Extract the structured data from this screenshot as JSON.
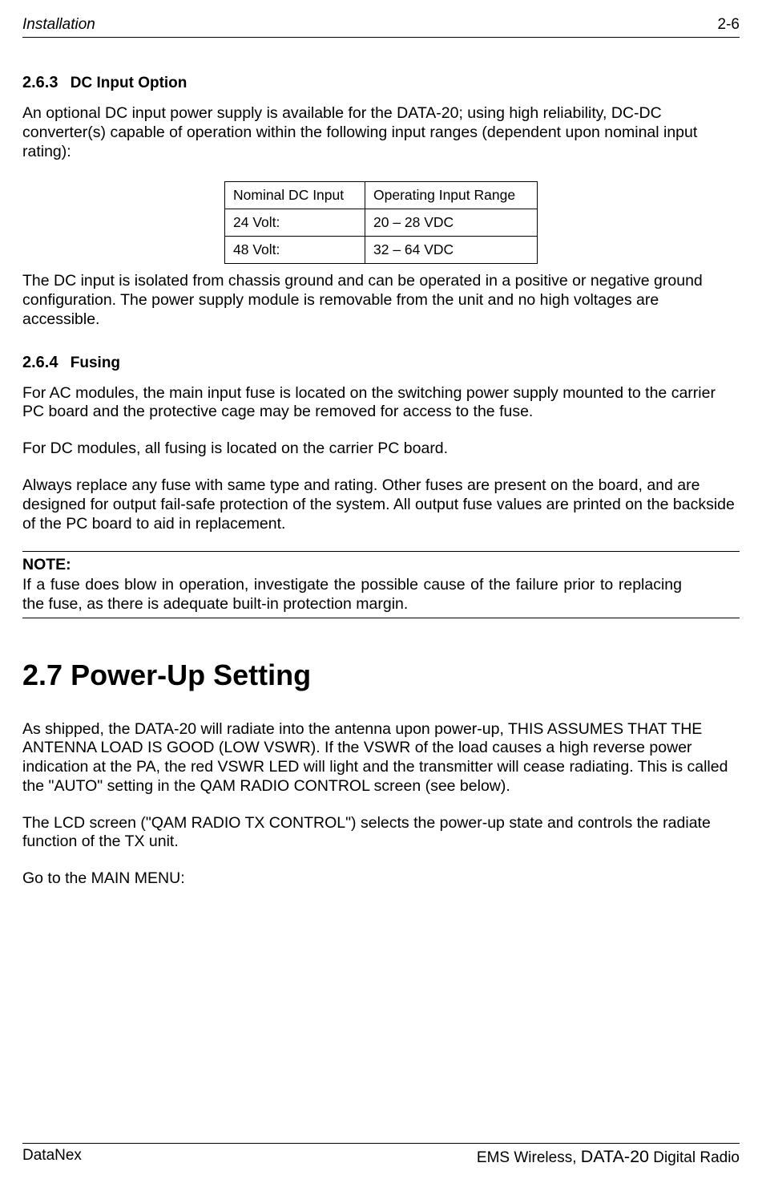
{
  "header": {
    "left": "Installation",
    "right": "2-6"
  },
  "section_263": {
    "number": "2.6.3",
    "title": "DC Input Option",
    "paragraph1": "An optional DC input power supply is available for the DATA-20; using high reliability, DC-DC converter(s) capable of operation within the following input ranges (dependent upon nominal input rating):",
    "table": {
      "headers": {
        "col1": "Nominal DC Input",
        "col2": "Operating Input Range"
      },
      "rows": [
        {
          "col1": "24 Volt:",
          "col2": "20 – 28 VDC"
        },
        {
          "col1": "48 Volt:",
          "col2": "32 – 64 VDC"
        }
      ]
    },
    "paragraph2": "The DC input is isolated from chassis ground and can be operated in a positive or negative ground configuration.  The power supply module is removable from the unit and no high voltages are accessible."
  },
  "section_264": {
    "number": "2.6.4",
    "title": "Fusing",
    "paragraph1": "For AC modules, the main input fuse is located on the switching power supply mounted to the carrier PC board and the protective cage may be removed for access to the fuse.",
    "paragraph2": "For DC modules, all fusing is located on the carrier PC board.",
    "paragraph3": "Always replace any fuse with same type and rating.  Other fuses are present on the board, and are designed for output fail-safe protection of the system.  All output fuse values are printed on the backside of the PC board to aid in replacement.",
    "note_label": "NOTE:",
    "note_body": "If a fuse does blow in operation, investigate the possible cause of the failure prior to replacing the fuse, as there is adequate built-in protection margin."
  },
  "section_27": {
    "number": "2.7",
    "title": "Power-Up Setting",
    "paragraph1": "As shipped, the DATA-20  will radiate into the antenna upon power-up, THIS ASSUMES THAT THE ANTENNA LOAD IS GOOD (LOW VSWR).  If the VSWR of the load causes a high reverse power indication at the PA, the red VSWR LED will light and the transmitter will cease radiating.  This is called the \"AUTO\" setting in the QAM RADIO CONTROL screen (see below).",
    "paragraph2": "The LCD screen (\"QAM RADIO TX CONTROL\") selects the power-up state and controls the radiate function of the TX unit.",
    "paragraph3": "Go to the MAIN MENU:"
  },
  "footer": {
    "left": "DataNex",
    "right_prefix": "EMS Wireless, ",
    "right_product": "DATA-20",
    "right_suffix": " Digital Radio"
  }
}
